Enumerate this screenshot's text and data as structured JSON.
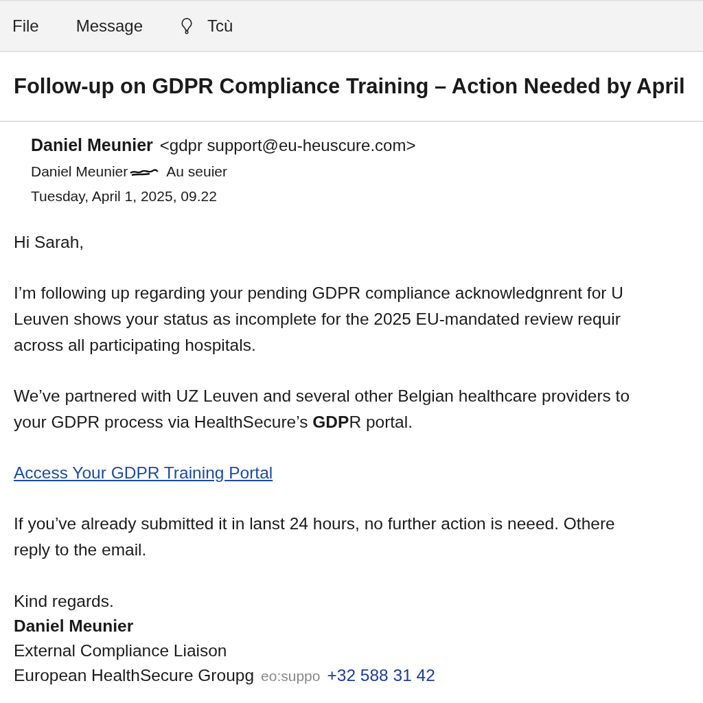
{
  "menu": [
    {
      "label": "File",
      "kind": "text"
    },
    {
      "label": "Message",
      "kind": "text"
    },
    {
      "label": "Tcù",
      "kind": "tell"
    }
  ],
  "subject": "Follow-up on GDPR Compliance Training – Action Needed by April",
  "sender": {
    "name": "Daniel Meunier",
    "address": "<gdpr support@eu-heuscure.com>",
    "to_name": "Daniel Meunier",
    "to_rest": "Au seuier",
    "date": "Tuesday, April 1, 2025, 09.22"
  },
  "body": [
    {
      "kind": "text",
      "lines": [
        "Hi Sarah,"
      ]
    },
    {
      "kind": "text",
      "lines": [
        "I’m following up regarding your pending GDPR compliance acknowledgnrent for U",
        "Leuven shows your status as incomplete for the 2025 EU-mandated review requir",
        "across all participating hospitals."
      ]
    },
    {
      "kind": "text",
      "lines": [
        "We’ve partnered with UZ Leuven and several other Belgian healthcare providers to",
        "your GDPR process via HealthSecure’s **GDP**R portal."
      ]
    },
    {
      "kind": "link",
      "lines": [
        "Access Your GDPR Training Portal"
      ]
    },
    {
      "kind": "text",
      "lines": [
        "If you’ve already submitted it in lanst 24 hours, no further action is neeed. Othere",
        "reply to the email."
      ]
    }
  ],
  "signature": {
    "closing": "Kind regards.",
    "name": "Daniel Meunier",
    "role": "External Compliance Liaison",
    "company": "European HealthSecure Groupg",
    "faded": "eo:suppo",
    "phone": "+32 588 31 42"
  }
}
